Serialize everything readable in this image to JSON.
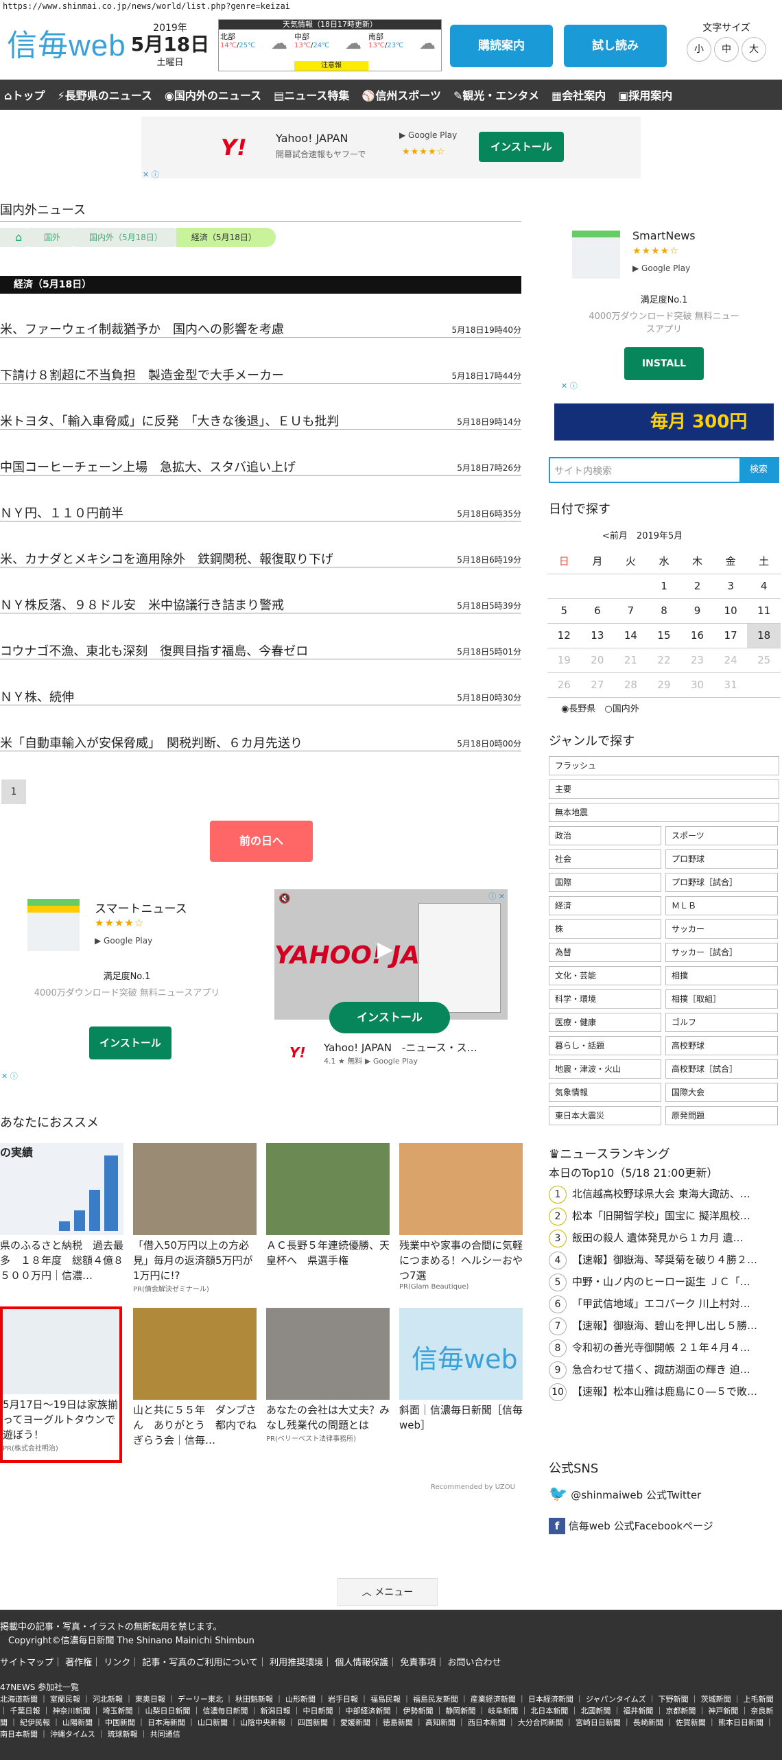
{
  "url": "https://www.shinmai.co.jp/news/world/list.php?genre=keizai",
  "logo": "信毎web",
  "date": {
    "year": "2019年",
    "md": "5月18日",
    "wd": "土曜日"
  },
  "weather": {
    "title": "天気情報（18日17時更新）",
    "regions": [
      {
        "name": "北部",
        "hi": "14℃",
        "lo": "25℃"
      },
      {
        "name": "中部",
        "hi": "13℃",
        "lo": "24℃"
      },
      {
        "name": "南部",
        "hi": "13℃",
        "lo": "23℃"
      }
    ],
    "alert": "注意報"
  },
  "buttons": {
    "subscribe": "購読案内",
    "trial": "試し読み"
  },
  "fontsize": {
    "label": "文字サイズ",
    "small": "小",
    "medium": "中",
    "large": "大"
  },
  "nav": [
    "トップ",
    "長野県のニュース",
    "国内外のニュース",
    "ニュース特集",
    "信州スポーツ",
    "観光・エンタメ",
    "会社案内",
    "採用案内"
  ],
  "ad_top": {
    "brand": "Y!",
    "title": "Yahoo! JAPAN",
    "sub": "開幕試合速報もヤフーで",
    "store": "Google Play",
    "stars": "★★★★☆",
    "install": "インストール"
  },
  "section_title": "国内外ニュース",
  "breadcrumb": [
    "国外",
    "国内外（5月18日）",
    "経済（5月18日）"
  ],
  "category_header": "経済（5月18日）",
  "articles": [
    {
      "t": "米、ファーウェイ制裁猶予か　国内への影響を考慮",
      "d": "5月18日19時40分"
    },
    {
      "t": "下請け８割超に不当負担　製造金型で大手メーカー",
      "d": "5月18日17時44分"
    },
    {
      "t": "米トヨタ、「輸入車脅威」に反発　「大きな後退」、ＥＵも批判",
      "d": "5月18日9時14分"
    },
    {
      "t": "中国コーヒーチェーン上場　急拡大、スタバ追い上げ",
      "d": "5月18日7時26分"
    },
    {
      "t": "ＮＹ円、１１０円前半",
      "d": "5月18日6時35分"
    },
    {
      "t": "米、カナダとメキシコを適用除外　鉄鋼関税、報復取り下げ",
      "d": "5月18日6時19分"
    },
    {
      "t": "ＮＹ株反落、９８ドル安　米中協議行き詰まり警戒",
      "d": "5月18日5時39分"
    },
    {
      "t": "コウナゴ不漁、東北も深刻　復興目指す福島、今春ゼロ",
      "d": "5月18日5時01分"
    },
    {
      "t": "ＮＹ株、続伸",
      "d": "5月18日0時30分"
    },
    {
      "t": "米「自動車輸入が安保脅威」　関税判断、６カ月先送り",
      "d": "5月18日0時00分"
    }
  ],
  "page": "1",
  "prev_day": "前の日へ",
  "ad_smart": {
    "title": "スマートニュース",
    "stars": "★★★★☆",
    "store": "Google Play",
    "sat": "満足度No.1",
    "desc": "4000万ダウンロード突破 無料ニュースアプリ",
    "install": "インストール"
  },
  "ad_yahoo": {
    "install": "インストール",
    "name": "Yahoo! JAPAN　-ニュース・ス…",
    "rating": "4.1 ★ 無料",
    "store": "Google Play",
    "logo": "YAHOO! JAPAN"
  },
  "rec_title": "あなたにおススメ",
  "recs": [
    {
      "t": "県のふるさと納税　過去最多　１８年度　総額４億８５００万円｜信濃…",
      "pr": "",
      "img": "の実績"
    },
    {
      "t": "「借入50万円以上の方必見」毎月の返済額5万円が1万円に!?",
      "pr": "PR(債会解決ゼミナール)",
      "img": ""
    },
    {
      "t": "ＡＣ長野５年連続優勝、天皇杯へ　県選手権",
      "pr": "",
      "img": ""
    },
    {
      "t": "残業中や家事の合間に気軽につまめる！ヘルシーおやつ7選",
      "pr": "PR(Glam Beautique)",
      "img": ""
    },
    {
      "t": "5月17日〜19日は家族揃ってヨーグルトタウンで遊ぼう！",
      "pr": "PR(株式会社明治)",
      "img": ""
    },
    {
      "t": "山と共に５５年　ダンプさん　ありがとう　都内でねぎらう会｜信毎…",
      "pr": "",
      "img": ""
    },
    {
      "t": "あなたの会社は大丈夫？みなし残業代の問題とは",
      "pr": "PR(ベリーベスト法律事務所)",
      "img": ""
    },
    {
      "t": "斜面｜信濃毎日新聞［信毎web］",
      "pr": "",
      "img": "信毎web"
    }
  ],
  "recommended_by": "Recommended by UZOU",
  "side_ad": {
    "title": "SmartNews",
    "stars": "★★★★☆",
    "store": "Google Play",
    "sat": "満足度No.1",
    "desc": "4000万ダウンロード突破 無料ニュースアプリ",
    "install": "INSTALL",
    "banner": "毎月 300円"
  },
  "search": {
    "placeholder": "サイト内検索",
    "button": "検索"
  },
  "cal": {
    "title": "日付で探す",
    "prev": "<前月",
    "month": "2019年5月",
    "heads": [
      "日",
      "月",
      "火",
      "水",
      "木",
      "金",
      "土"
    ],
    "rows": [
      [
        "",
        "",
        "",
        "1",
        "2",
        "3",
        "4"
      ],
      [
        "5",
        "6",
        "7",
        "8",
        "9",
        "10",
        "11"
      ],
      [
        "12",
        "13",
        "14",
        "15",
        "16",
        "17",
        "18"
      ],
      [
        "19",
        "20",
        "21",
        "22",
        "23",
        "24",
        "25"
      ],
      [
        "26",
        "27",
        "28",
        "29",
        "30",
        "31",
        ""
      ]
    ],
    "radio": [
      "長野県",
      "国内外"
    ]
  },
  "genre": {
    "title": "ジャンルで探す",
    "full": [
      "フラッシュ",
      "主要",
      "無本地震"
    ],
    "pairs": [
      [
        "政治",
        "スポーツ"
      ],
      [
        "社会",
        "プロ野球"
      ],
      [
        "国際",
        "プロ野球［試合］"
      ],
      [
        "経済",
        "ＭＬＢ"
      ],
      [
        "株",
        "サッカー"
      ],
      [
        "為替",
        "サッカー［試合］"
      ],
      [
        "文化・芸能",
        "相撲"
      ],
      [
        "科学・環境",
        "相撲［取組］"
      ],
      [
        "医療・健康",
        "ゴルフ"
      ],
      [
        "暮らし・話題",
        "高校野球"
      ],
      [
        "地震・津波・火山",
        "高校野球［試合］"
      ],
      [
        "気象情報",
        "国際大会"
      ],
      [
        "東日本大震災",
        "原発問題"
      ]
    ]
  },
  "ranking": {
    "title": "ニュースランキング",
    "sub": "本日のTop10（5/18 21:00更新）",
    "items": [
      "北信越高校野球県大会 東海大諏訪、…",
      "松本「旧開智学校」国宝に 擬洋風校…",
      "飯田の殺人 遺体発見から１カ月 遺…",
      "【速報】御嶽海、琴奨菊を破り４勝２…",
      "中野・山ノ内のヒーロー誕生 ＪＣ「…",
      "「甲武信地域」エコパーク 川上村対…",
      "【速報】御嶽海、碧山を押し出し５勝…",
      "令和初の善光寺御開帳 ２１年４月４…",
      "急合わせて描く、諏訪湖面の輝き 迫…",
      "【速報】松本山雅は鹿島に０―５で敗…"
    ]
  },
  "sns": {
    "title": "公式SNS",
    "twitter": "@shinmaiweb 公式Twitter",
    "facebook": "信毎web 公式Facebookページ"
  },
  "menu": "メニュー",
  "footer": {
    "l1": "掲載中の記事・写真・イラストの無断転用を禁じます。",
    "l2": "Copyright©信濃毎日新聞 The Shinano Mainichi Shimbun",
    "links": "サイトマップ｜ 著作権｜ リンク｜ 記事・写真のご利用について｜ 利用推奨環境｜ 個人情報保護｜ 免責事項｜ お問い合わせ",
    "net": "47NEWS 参加社一覧",
    "papers": "北海道新聞 ｜ 室蘭民報 ｜ 河北新報 ｜ 東奥日報 ｜ デーリー東北 ｜ 秋田魁新報 ｜ 山形新聞 ｜ 岩手日報 ｜ 福島民報 ｜ 福島民友新聞 ｜ 産業経済新聞 ｜ 日本経済新聞 ｜ ジャパンタイムズ ｜ 下野新聞 ｜ 茨城新聞 ｜ 上毛新聞 ｜ 千葉日報 ｜ 神奈川新聞 ｜ 埼玉新聞 ｜ 山梨日日新聞 ｜ 信濃毎日新聞 ｜ 新潟日報 ｜ 中日新聞 ｜ 中部経済新聞 ｜ 伊勢新聞 ｜ 静岡新聞 ｜ 岐阜新聞 ｜ 北日本新聞 ｜ 北國新聞 ｜ 福井新聞 ｜ 京都新聞 ｜ 神戸新聞 ｜ 奈良新聞 ｜ 紀伊民報 ｜ 山陽新聞 ｜ 中国新聞 ｜ 日本海新聞 ｜ 山口新聞 ｜ 山陰中央新報 ｜ 四国新聞 ｜ 愛媛新聞 ｜ 徳島新聞 ｜ 高知新聞 ｜ 西日本新聞 ｜ 大分合同新聞 ｜ 宮崎日日新聞 ｜ 長崎新聞 ｜ 佐賀新聞 ｜ 熊本日日新聞 ｜ 南日本新聞 ｜ 沖縄タイムス ｜ 琉球新報 ｜ 共同通信"
  }
}
